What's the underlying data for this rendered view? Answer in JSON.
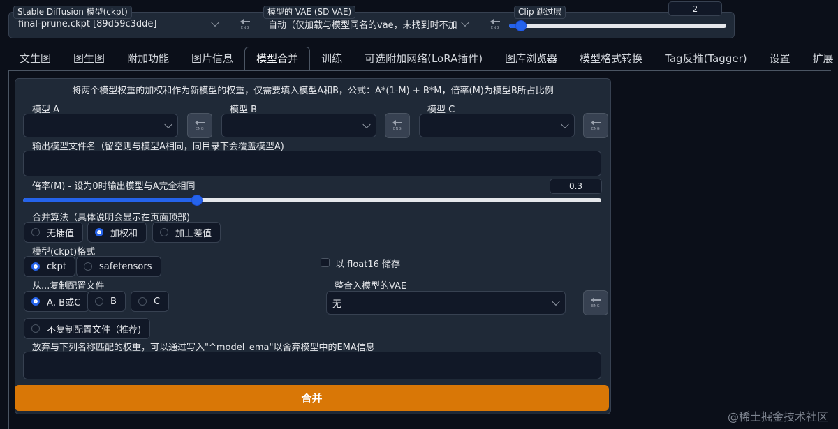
{
  "top": {
    "ckpt_label": "Stable Diffusion 模型(ckpt)",
    "ckpt_value": "final-prune.ckpt [89d59c3dde]",
    "vae_label": "模型的 VAE (SD VAE)",
    "vae_value": "自动（仅加载与模型同名的vae，未找到时不加",
    "clip_label": "Clip 跳过层",
    "clip_value": "2",
    "clip_slider_fraction": 0.05,
    "refresh_caption": "ENG"
  },
  "tabs": [
    {
      "label": "文生图"
    },
    {
      "label": "图生图"
    },
    {
      "label": "附加功能"
    },
    {
      "label": "图片信息"
    },
    {
      "label": "模型合并"
    },
    {
      "label": "训练"
    },
    {
      "label": "可选附加网络(LoRA插件)"
    },
    {
      "label": "图库浏览器"
    },
    {
      "label": "模型格式转换"
    },
    {
      "label": "Tag反推(Tagger)"
    },
    {
      "label": "设置"
    },
    {
      "label": "扩展"
    }
  ],
  "active_tab": "模型合并",
  "merge": {
    "description": "将两个模型权重的加权和作为新模型的权重，仅需要填入模型A和B，公式：A*(1-M) + B*M，倍率(M)为模型B所占比例",
    "model_a_label": "模型 A",
    "model_b_label": "模型 B",
    "model_c_label": "模型 C",
    "output_label": "输出模型文件名（留空则与模型A相同，同目录下会覆盖模型A)",
    "multiplier_label": "倍率(M) - 设为0时输出模型与A完全相同",
    "multiplier_value": "0.3",
    "multiplier_fraction": 0.3,
    "algo_label": "合并算法（具体说明会显示在页面顶部)",
    "algo_options": [
      "无插值",
      "加权和",
      "加上差值"
    ],
    "algo_selected": "加权和",
    "format_label": "模型(ckpt)格式",
    "format_options": [
      "ckpt",
      "safetensors"
    ],
    "format_selected": "ckpt",
    "float16_label": "以 float16 储存",
    "copy_label": "从...复制配置文件",
    "copy_options": [
      "A, B或C",
      "B",
      "C"
    ],
    "copy_selected": "A, B或C",
    "no_copy_label": "不复制配置文件（推荐)",
    "bake_vae_label": "整合入模型的VAE",
    "bake_vae_value": "无",
    "discard_label": "放弃与下列名称匹配的权重，可以通过写入\"^model_ema\"以舍弃模型中的EMA信息",
    "merge_button": "合并"
  },
  "watermark": "@稀土掘金技术社区",
  "colors": {
    "background": "#0b0f19",
    "panel": "#1f2937",
    "accent": "#2563eb",
    "primary_button": "#d97706"
  }
}
